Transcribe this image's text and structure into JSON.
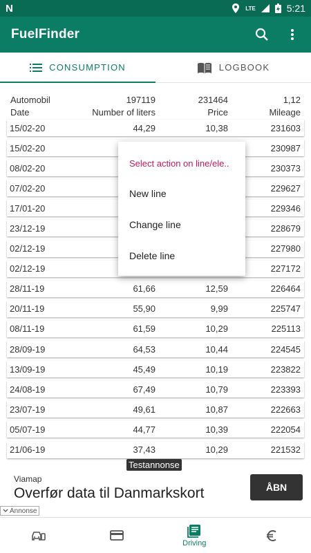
{
  "status_bar": {
    "time": "5:21",
    "network": "LTE"
  },
  "app": {
    "title": "FuelFinder"
  },
  "tabs": [
    {
      "label": "CONSUMPTION",
      "icon": "list-icon",
      "active": true
    },
    {
      "label": "LOGBOOK",
      "icon": "book-icon",
      "active": false
    }
  ],
  "summary": {
    "c1": "Automobil",
    "c2": "197119",
    "c3": "231464",
    "c4": "1,12"
  },
  "headers": {
    "c1": "Date",
    "c2": "Number of liters",
    "c3": "Price",
    "c4": "Mileage"
  },
  "rows": [
    [
      "15/02-20",
      "44,29",
      "10,38",
      "231603"
    ],
    [
      "15/02-20",
      "",
      "",
      "230987"
    ],
    [
      "08/02-20",
      "",
      "",
      "230373"
    ],
    [
      "07/02-20",
      "",
      "",
      "229627"
    ],
    [
      "17/01-20",
      "",
      "",
      "229346"
    ],
    [
      "23/12-19",
      "",
      "",
      "228679"
    ],
    [
      "02/12-19",
      "",
      "",
      "227980"
    ],
    [
      "02/12-19",
      "",
      "",
      "227172"
    ],
    [
      "28/11-19",
      "61,66",
      "12,59",
      "226464"
    ],
    [
      "20/11-19",
      "55,90",
      "9,99",
      "225747"
    ],
    [
      "08/11-19",
      "61,59",
      "10,29",
      "225113"
    ],
    [
      "28/09-19",
      "64,53",
      "10,44",
      "224545"
    ],
    [
      "13/09-19",
      "45,49",
      "10,19",
      "223822"
    ],
    [
      "24/08-19",
      "67,49",
      "10,79",
      "223393"
    ],
    [
      "23/07-19",
      "49,61",
      "10,87",
      "222663"
    ],
    [
      "05/07-19",
      "44,77",
      "10,39",
      "222054"
    ],
    [
      "21/06-19",
      "37,43",
      "10,29",
      "221532"
    ]
  ],
  "popup": {
    "title": "Select action on line/ele..",
    "items": [
      "New line",
      "Change line",
      "Delete line"
    ]
  },
  "ad": {
    "label": "Testannonse",
    "brand": "Viamap",
    "headline": "Overfør data til Danmarkskort",
    "cta": "ÅBN",
    "badge": "Annonse"
  },
  "bottom_nav": [
    {
      "icon": "car-icon",
      "label": ""
    },
    {
      "icon": "card-icon",
      "label": ""
    },
    {
      "icon": "notes-icon",
      "label": "Driving",
      "active": true
    },
    {
      "icon": "euro-icon",
      "label": ""
    }
  ],
  "colors": {
    "primary": "#0b7d65",
    "primary_dark": "#0a6b54",
    "accent": "#c2185b"
  }
}
